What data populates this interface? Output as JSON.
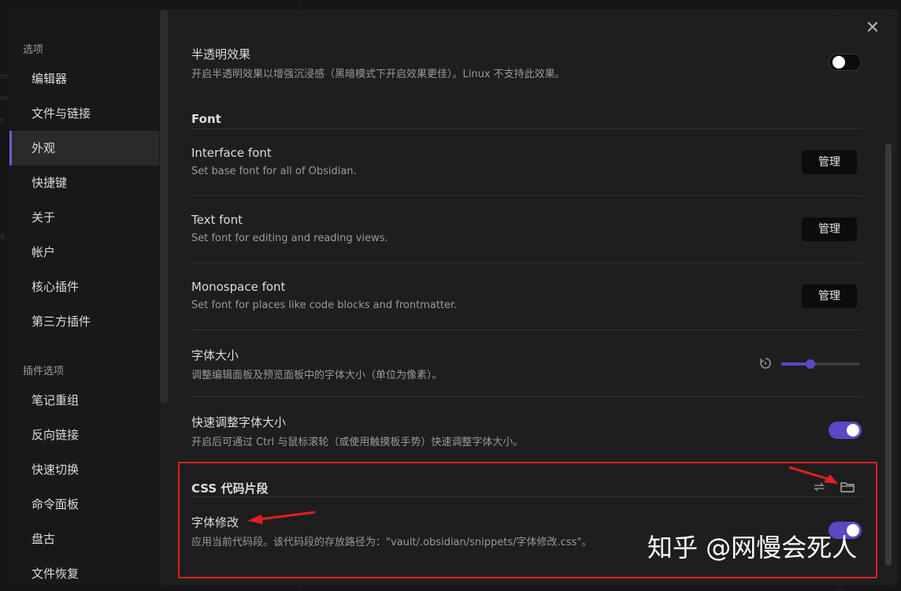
{
  "sidebar": {
    "options_header": "选项",
    "options_items": [
      {
        "label": "编辑器"
      },
      {
        "label": "文件与链接"
      },
      {
        "label": "外观",
        "active": true
      },
      {
        "label": "快捷键"
      },
      {
        "label": "关于"
      },
      {
        "label": "帐户"
      },
      {
        "label": "核心插件"
      },
      {
        "label": "第三方插件"
      }
    ],
    "plugin_header": "插件选项",
    "plugin_items": [
      {
        "label": "笔记重组"
      },
      {
        "label": "反向链接"
      },
      {
        "label": "快速切换"
      },
      {
        "label": "命令面板"
      },
      {
        "label": "盘古"
      },
      {
        "label": "文件恢复"
      }
    ]
  },
  "settings": {
    "translucent": {
      "name": "半透明效果",
      "desc": "开启半透明效果以增强沉浸感（黑暗模式下开启效果更佳）。Linux 不支持此效果。",
      "enabled": false
    },
    "font_section": "Font",
    "interface_font": {
      "name": "Interface font",
      "desc": "Set base font for all of Obsidian.",
      "button": "管理"
    },
    "text_font": {
      "name": "Text font",
      "desc": "Set font for editing and reading views.",
      "button": "管理"
    },
    "monospace_font": {
      "name": "Monospace font",
      "desc": "Set font for places like code blocks and frontmatter.",
      "button": "管理"
    },
    "font_size": {
      "name": "字体大小",
      "desc": "调整编辑面板及预览面板中的字体大小（单位为像素）。",
      "slider_fraction": 0.37
    },
    "quick_font_size": {
      "name": "快速调整字体大小",
      "desc": "开启后可通过 Ctrl 与鼠标滚轮（或使用触摸板手势）快速调整字体大小。",
      "enabled": true
    },
    "css_section": "CSS 代码片段",
    "snippet": {
      "name": "字体修改",
      "desc": "应用当前代码段。该代码段的存放路径为：\"vault/.obsidian/snippets/字体修改.css\"。",
      "enabled": true
    }
  },
  "watermark": "知乎 @网慢会死人",
  "icons": {
    "close": "close-icon",
    "reset": "reset-icon",
    "reload": "reload-icon",
    "folder": "folder-icon"
  },
  "colors": {
    "accent": "#5a48c4",
    "annotation": "#e02020"
  }
}
